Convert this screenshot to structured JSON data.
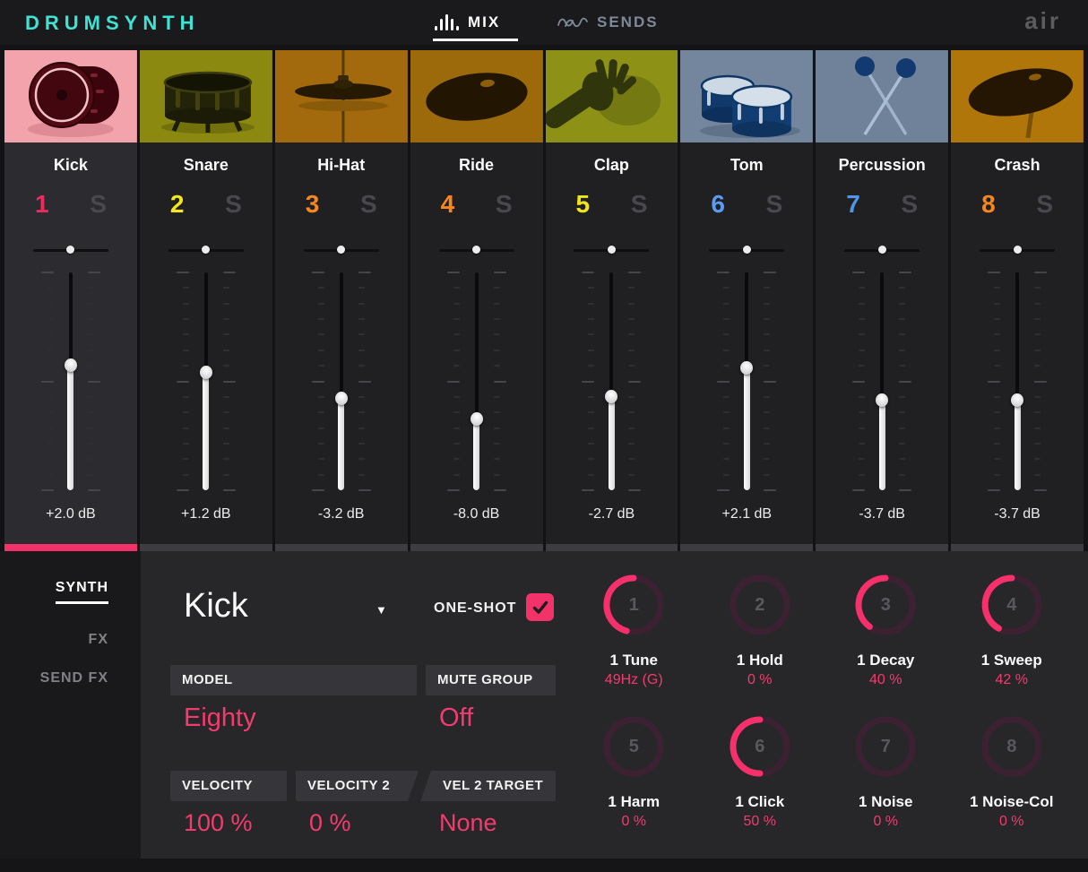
{
  "header": {
    "logo": "DRUMSYNTH",
    "tabs": [
      {
        "label": "MIX",
        "active": true
      },
      {
        "label": "SENDS",
        "active": false
      }
    ],
    "brand": "air"
  },
  "colors": {
    "accent_pink": "#f23268",
    "logo_cyan": "#3fe3d3",
    "value_pink": "#f23b6e",
    "inactive_tab": "#7e8a9a",
    "solo_gray": "#48484e"
  },
  "channels": [
    {
      "name": "Kick",
      "number": "1",
      "number_color": "#f0295f",
      "solo": "S",
      "image": "kick",
      "pan": 0.5,
      "fader_pos": 0.43,
      "db": "+2.0 dB",
      "selected": true
    },
    {
      "name": "Snare",
      "number": "2",
      "number_color": "#f5e71e",
      "solo": "S",
      "image": "snare",
      "pan": 0.5,
      "fader_pos": 0.46,
      "db": "+1.2 dB",
      "selected": false
    },
    {
      "name": "Hi-Hat",
      "number": "3",
      "number_color": "#f5871e",
      "solo": "S",
      "image": "hihat",
      "pan": 0.5,
      "fader_pos": 0.58,
      "db": "-3.2 dB",
      "selected": false
    },
    {
      "name": "Ride",
      "number": "4",
      "number_color": "#f5871e",
      "solo": "S",
      "image": "ride",
      "pan": 0.5,
      "fader_pos": 0.675,
      "db": "-8.0 dB",
      "selected": false
    },
    {
      "name": "Clap",
      "number": "5",
      "number_color": "#f0e51c",
      "solo": "S",
      "image": "clap",
      "pan": 0.5,
      "fader_pos": 0.57,
      "db": "-2.7 dB",
      "selected": false
    },
    {
      "name": "Tom",
      "number": "6",
      "number_color": "#5b9cf0",
      "solo": "S",
      "image": "tom",
      "pan": 0.5,
      "fader_pos": 0.44,
      "db": "+2.1 dB",
      "selected": false
    },
    {
      "name": "Percussion",
      "number": "7",
      "number_color": "#4f96ea",
      "solo": "S",
      "image": "percussion",
      "pan": 0.5,
      "fader_pos": 0.59,
      "db": "-3.7 dB",
      "selected": false
    },
    {
      "name": "Crash",
      "number": "8",
      "number_color": "#f5871e",
      "solo": "S",
      "image": "crash",
      "pan": 0.5,
      "fader_pos": 0.59,
      "db": "-3.7 dB",
      "selected": false
    }
  ],
  "sidebar": {
    "items": [
      {
        "label": "SYNTH",
        "active": true
      },
      {
        "label": "FX",
        "active": false
      },
      {
        "label": "SEND FX",
        "active": false
      }
    ]
  },
  "panel": {
    "instrument": "Kick",
    "one_shot_label": "ONE-SHOT",
    "one_shot_checked": true,
    "model_label": "MODEL",
    "model_value": "Eighty",
    "mute_group_label": "MUTE GROUP",
    "mute_group_value": "Off",
    "velocity_label": "VELOCITY",
    "velocity_value": "100 %",
    "velocity2_label": "VELOCITY 2",
    "velocity2_value": "0 %",
    "vel2_target_label": "VEL 2 TARGET",
    "vel2_target_value": "None",
    "knobs": [
      {
        "number": "1",
        "label": "1 Tune",
        "value": "49Hz (G)",
        "arc_deg": 165
      },
      {
        "number": "2",
        "label": "1 Hold",
        "value": "0 %",
        "arc_deg": 0
      },
      {
        "number": "3",
        "label": "1 Decay",
        "value": "40 %",
        "arc_deg": 144
      },
      {
        "number": "4",
        "label": "1 Sweep",
        "value": "42 %",
        "arc_deg": 151
      },
      {
        "number": "5",
        "label": "1 Harm",
        "value": "0 %",
        "arc_deg": 0
      },
      {
        "number": "6",
        "label": "1 Click",
        "value": "50 %",
        "arc_deg": 180
      },
      {
        "number": "7",
        "label": "1 Noise",
        "value": "0 %",
        "arc_deg": 0
      },
      {
        "number": "8",
        "label": "1 Noise-Col",
        "value": "0 %",
        "arc_deg": 0
      }
    ]
  }
}
